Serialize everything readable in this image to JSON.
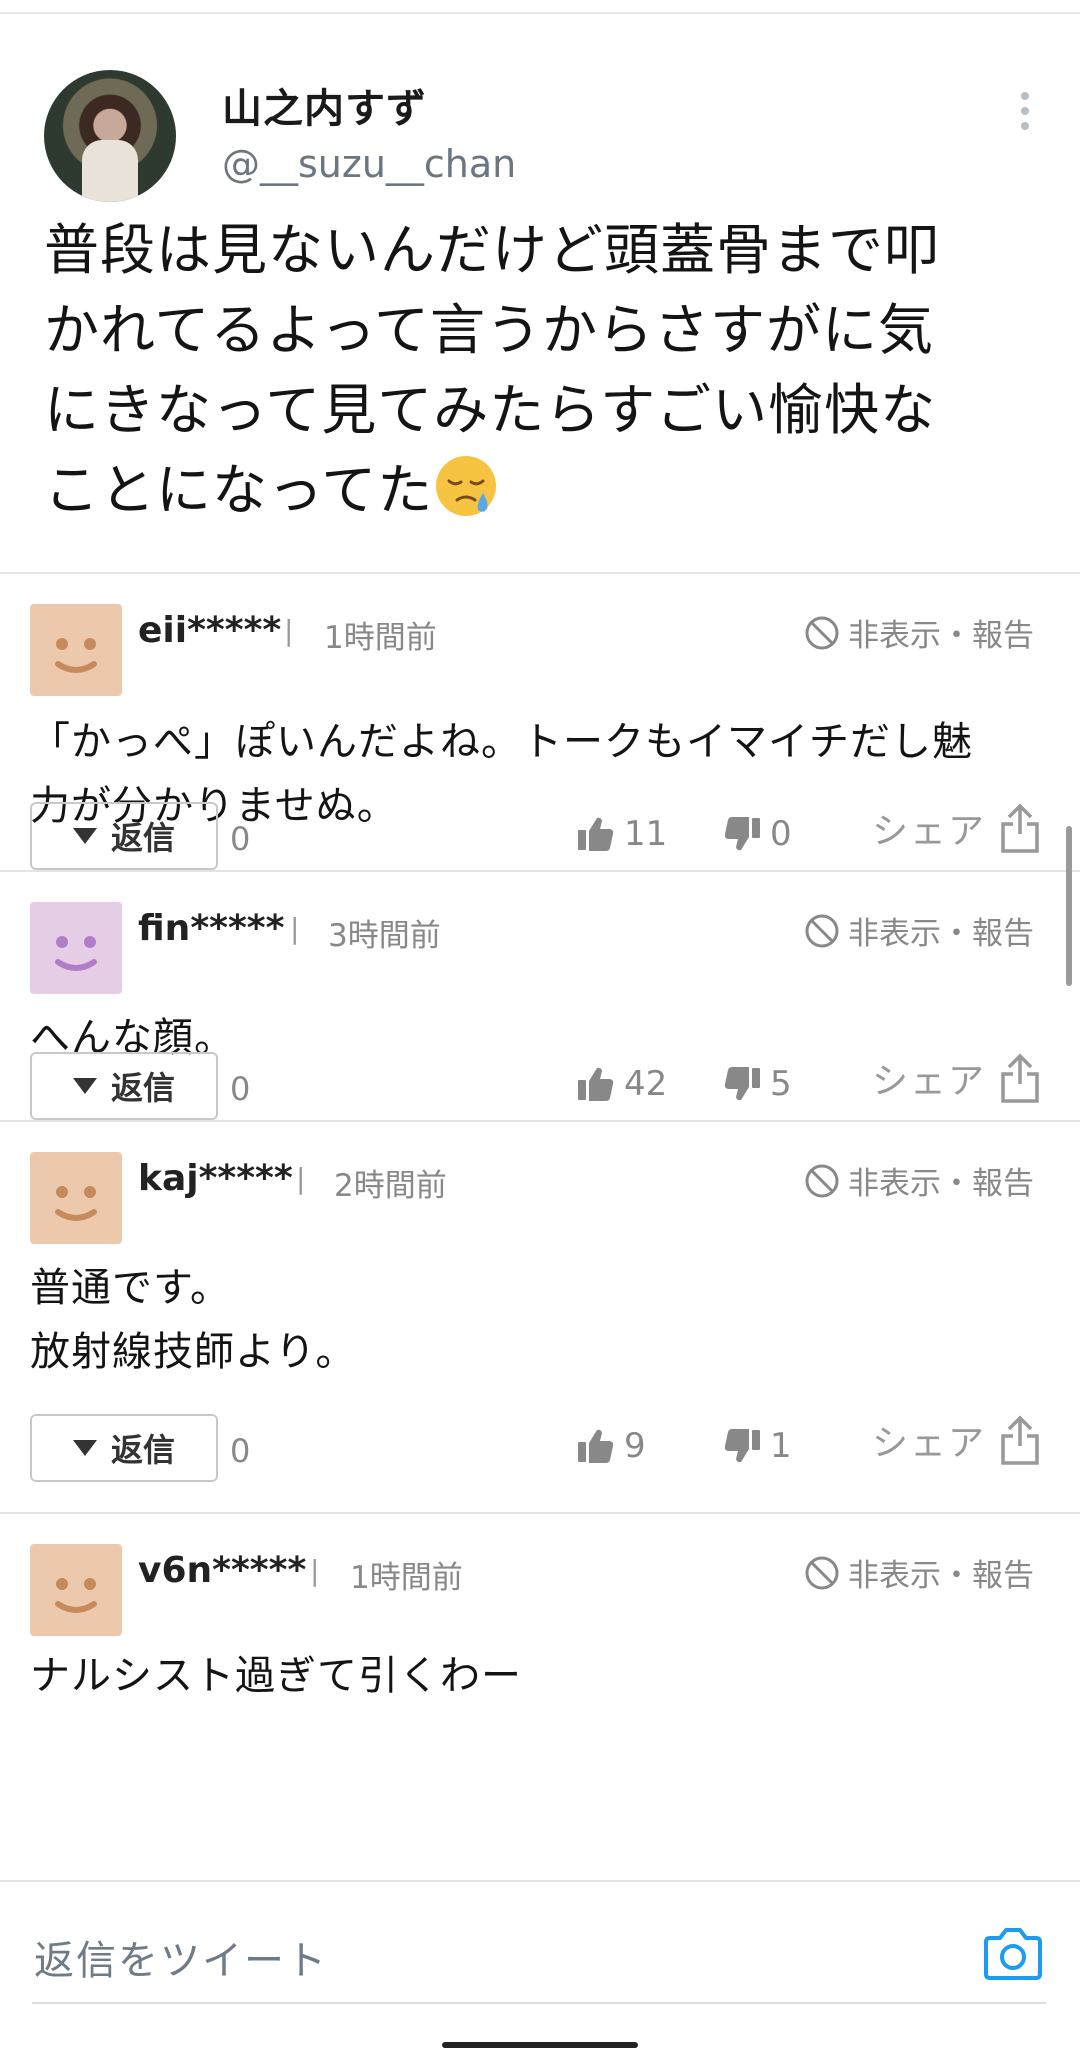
{
  "tweet": {
    "display_name": "山之内すず",
    "handle": "@__suzu__chan",
    "text_lines": [
      "普段は見ないんだけど頭蓋骨まで叩",
      "かれてるよって言うからさすがに気",
      "にきなって見てみたらすごい愉快な",
      "ことになってた"
    ],
    "emoji": "sad-relieved-face"
  },
  "comments": [
    {
      "user": "eii*****",
      "separator": "|",
      "time": "1時間前",
      "hide_report": "非表示・報告",
      "body_lines": [
        "「かっぺ」ぽいんだよね。トークもイマイチだし魅",
        "力が分かりませぬ。"
      ],
      "reply_label": "返信",
      "reply_count": "0",
      "likes": "11",
      "dislikes": "0",
      "share_label": "シェア",
      "avatar_color": "#ecc9ad",
      "face_color": "#c68a5c"
    },
    {
      "user": "fin*****",
      "separator": "|",
      "time": "3時間前",
      "hide_report": "非表示・報告",
      "body_lines": [
        "へんな顔。"
      ],
      "reply_label": "返信",
      "reply_count": "0",
      "likes": "42",
      "dislikes": "5",
      "share_label": "シェア",
      "avatar_color": "#e6cde6",
      "face_color": "#b07ec8"
    },
    {
      "user": "kaj*****",
      "separator": "|",
      "time": "2時間前",
      "hide_report": "非表示・報告",
      "body_lines": [
        "普通です。",
        "放射線技師より。"
      ],
      "reply_label": "返信",
      "reply_count": "0",
      "likes": "9",
      "dislikes": "1",
      "share_label": "シェア",
      "avatar_color": "#ecc9ad",
      "face_color": "#c68a5c"
    },
    {
      "user": "v6n*****",
      "separator": "|",
      "time": "1時間前",
      "hide_report": "非表示・報告",
      "body_lines": [
        "ナルシスト過ぎて引くわー"
      ],
      "avatar_color": "#ecc9ad",
      "face_color": "#c68a5c"
    }
  ],
  "reply_bar": {
    "placeholder": "返信をツイート",
    "camera_icon": "camera-icon",
    "accent": "#1d9bf0"
  }
}
